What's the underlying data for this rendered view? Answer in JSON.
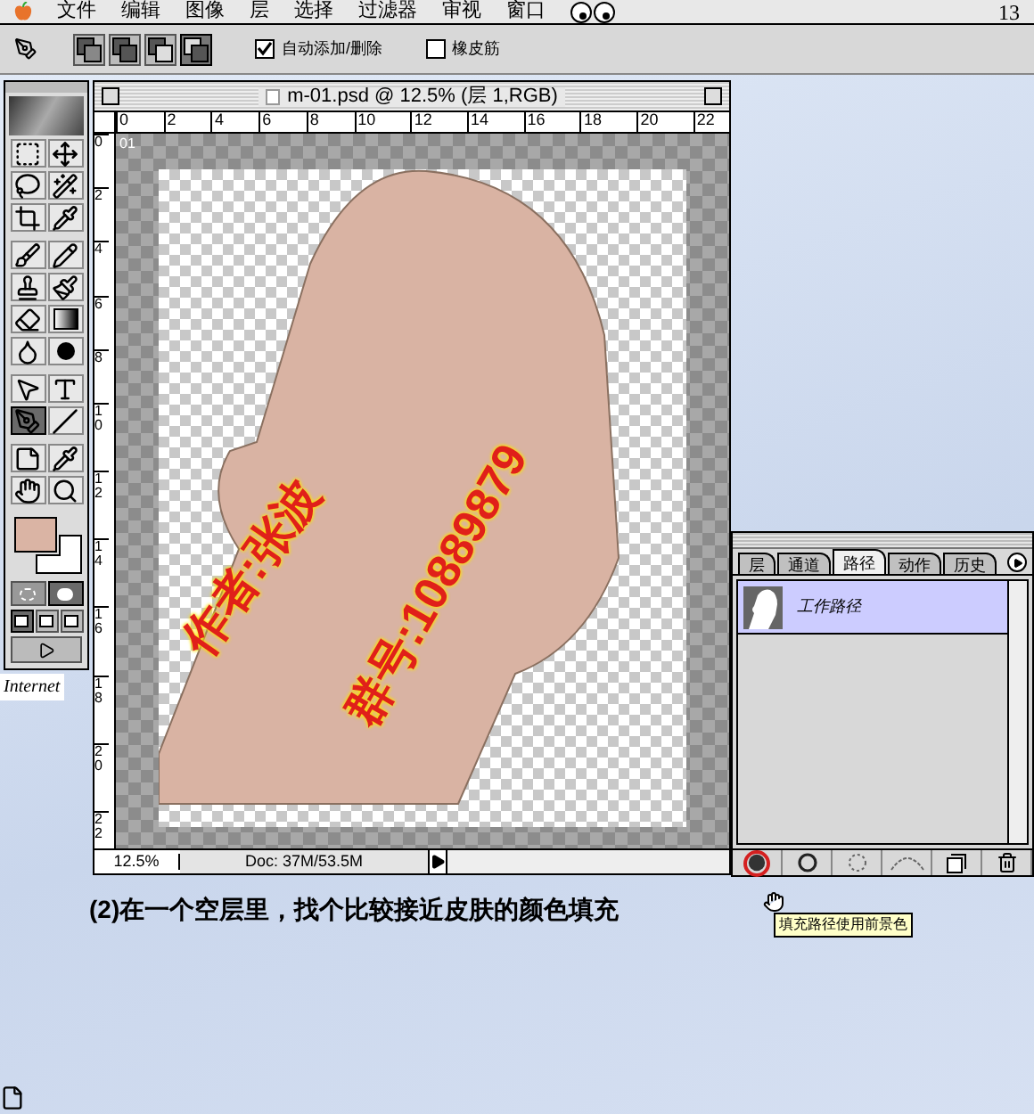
{
  "menu_bar": {
    "items": [
      "文件",
      "编辑",
      "图像",
      "层",
      "选择",
      "过滤器",
      "审视",
      "窗口"
    ],
    "clock": "13"
  },
  "options_bar": {
    "path_modes": [
      {
        "kind": "new",
        "selected": false
      },
      {
        "kind": "add",
        "selected": false
      },
      {
        "kind": "subtract",
        "selected": false
      },
      {
        "kind": "intersect",
        "selected": true
      }
    ],
    "checkboxes": [
      {
        "label": "自动添加/删除",
        "checked": true
      },
      {
        "label": "橡皮筋",
        "checked": false
      }
    ]
  },
  "toolbox": {
    "tools": [
      {
        "kind": "marquee",
        "selected": false
      },
      {
        "kind": "move",
        "selected": false
      },
      {
        "kind": "lasso",
        "selected": false
      },
      {
        "kind": "wand",
        "selected": false
      },
      {
        "kind": "crop",
        "selected": false
      },
      {
        "kind": "eyedropper",
        "selected": false
      },
      {
        "kind": "airbrush",
        "selected": false
      },
      {
        "kind": "pencil",
        "selected": false
      },
      {
        "kind": "stamp",
        "selected": false
      },
      {
        "kind": "history",
        "selected": false
      },
      {
        "kind": "eraser",
        "selected": false
      },
      {
        "kind": "gradient",
        "selected": false
      },
      {
        "kind": "blur",
        "selected": false
      },
      {
        "kind": "burn",
        "selected": false
      },
      {
        "kind": "pointer",
        "selected": false
      },
      {
        "kind": "text",
        "selected": false
      },
      {
        "kind": "pen",
        "selected": true
      },
      {
        "kind": "line",
        "selected": false
      },
      {
        "kind": "notes",
        "selected": false
      },
      {
        "kind": "eyedropper",
        "selected": false
      },
      {
        "kind": "hand",
        "selected": false
      },
      {
        "kind": "zoom",
        "selected": false
      }
    ],
    "swatches": [
      {
        "color": "#dab4a4"
      },
      {
        "color": "#ffffff"
      }
    ],
    "mask_modes": [
      {
        "selected": false
      },
      {
        "selected": true
      }
    ],
    "screen_modes": [
      {
        "selected": true
      },
      {
        "selected": false
      },
      {
        "selected": false
      }
    ]
  },
  "desktop_icon_label": "Internet",
  "document": {
    "title": "m-01.psd @ 12.5% (层 1,RGB)",
    "h_ruler": [
      "0",
      "2",
      "4",
      "6",
      "8",
      "10",
      "12",
      "14",
      "16",
      "18",
      "20",
      "22"
    ],
    "v_ruler": [
      "0",
      "2",
      "4",
      "6",
      "8",
      "10",
      "12",
      "14",
      "16",
      "18",
      "20",
      "22"
    ],
    "layer_tag": "01",
    "canvas_text": [
      "作者:张波",
      "群号:10889879"
    ],
    "zoom": "12.5%",
    "doc_info": "Doc: 37M/53.5M"
  },
  "paths_panel": {
    "tabs": [
      {
        "label": "层",
        "selected": false
      },
      {
        "label": "通道",
        "selected": false
      },
      {
        "label": "路径",
        "selected": true
      },
      {
        "label": "动作",
        "selected": false
      },
      {
        "label": "历史",
        "selected": false
      }
    ],
    "paths": [
      {
        "name": "工作路径",
        "selected": true
      }
    ],
    "buttons": [
      {
        "kind": "fill",
        "highlighted": true
      },
      {
        "kind": "stroke",
        "highlighted": false
      },
      {
        "kind": "selection",
        "highlighted": false
      },
      {
        "kind": "work-path",
        "highlighted": false
      },
      {
        "kind": "new",
        "highlighted": false
      },
      {
        "kind": "delete",
        "highlighted": false
      }
    ],
    "tooltip": "填充路径使用前景色"
  },
  "caption": "(2)在一个空层里，找个比较接近皮肤的颜色填充"
}
